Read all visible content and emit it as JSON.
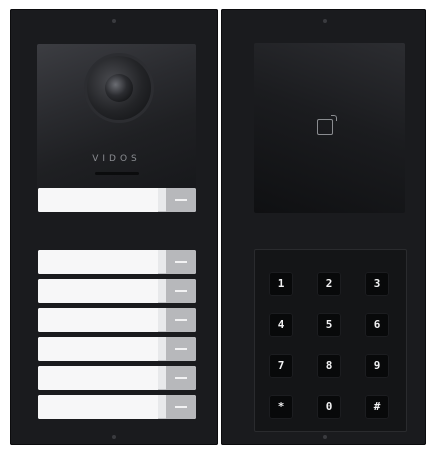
{
  "camera_module": {
    "brand": "VIDOS"
  },
  "name_plates_count_single": 1,
  "name_plates_count_group": 6,
  "keypad": {
    "keys": [
      "1",
      "2",
      "3",
      "4",
      "5",
      "6",
      "7",
      "8",
      "9",
      "*",
      "0",
      "#"
    ]
  },
  "icons": {
    "camera": "camera-lens-icon",
    "rfid": "rfid-card-icon",
    "call": "call-button-icon"
  },
  "colors": {
    "panel": "#1a1b1e",
    "plate": "#f7f7f8",
    "plate_button": "#b7b8bb",
    "key": "#08090a",
    "key_text": "#f2f2f3"
  }
}
